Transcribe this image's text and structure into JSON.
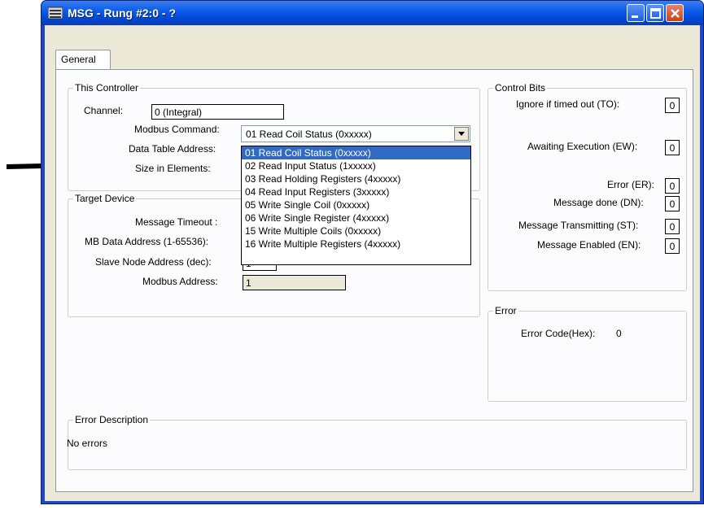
{
  "window": {
    "title": "MSG - Rung #2:0 - ?"
  },
  "tabs": [
    {
      "label": "General"
    }
  ],
  "this_controller": {
    "label": "This Controller",
    "channel_label": "Channel:",
    "channel_value": "0 (Integral)",
    "modbus_command_label": "Modbus Command:",
    "modbus_command_value": "01 Read Coil Status (0xxxxx)",
    "data_table_address_label": "Data Table Address:",
    "size_elements_label": "Size in Elements:"
  },
  "modbus_command_options": [
    "01 Read Coil Status (0xxxxx)",
    "02 Read Input Status (1xxxxx)",
    "03 Read Holding Registers (4xxxxx)",
    "04 Read Input Registers (3xxxxx)",
    "05 Write Single Coil (0xxxxx)",
    "06 Write Single Register (4xxxxx)",
    "15 Write Multiple Coils (0xxxxx)",
    "16 Write Multiple Registers (4xxxxx)"
  ],
  "target_device": {
    "label": "Target Device",
    "message_timeout_label": "Message Timeout :",
    "mb_data_address_label": "MB Data Address (1-65536):",
    "slave_node_address_label": "Slave Node Address (dec):",
    "slave_node_address_value": "1",
    "modbus_address_label": "Modbus Address:",
    "modbus_address_value": "1"
  },
  "control_bits": {
    "label": "Control Bits",
    "ignore_if_timed_out_label": "Ignore if timed out (TO):",
    "ignore_if_timed_out_value": "0",
    "awaiting_execution_label": "Awaiting Execution (EW):",
    "awaiting_execution_value": "0",
    "error_label": "Error (ER):",
    "error_value": "0",
    "message_done_label": "Message done (DN):",
    "message_done_value": "0",
    "message_transmitting_label": "Message Transmitting (ST):",
    "message_transmitting_value": "0",
    "message_enabled_label": "Message Enabled (EN):",
    "message_enabled_value": "0"
  },
  "error_group": {
    "label": "Error",
    "error_code_label": "Error Code(Hex):",
    "error_code_value": "0"
  },
  "error_description": {
    "label": "Error Description",
    "text": "No errors"
  },
  "colors": {
    "titlebar": "#0c5de8",
    "selection": "#316ac5",
    "face": "#ece9d8"
  }
}
